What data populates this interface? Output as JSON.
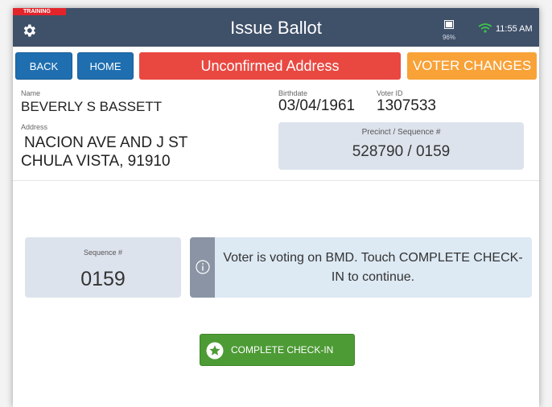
{
  "status_bar": {
    "training_label": "TRAINING",
    "settings_icon": "gear-icon",
    "title": "Issue Ballot",
    "battery_percent": "96%",
    "time": "11:55 AM"
  },
  "actions": {
    "back_label": "BACK",
    "home_label": "HOME",
    "address_status": "Unconfirmed Address",
    "voter_changes_label": "VOTER CHANGES"
  },
  "voter": {
    "name_label": "Name",
    "name": "BEVERLY S BASSETT",
    "birthdate_label": "Birthdate",
    "birthdate": "03/04/1961",
    "voter_id_label": "Voter ID",
    "voter_id": "1307533",
    "address_label": "Address",
    "address_line1": "NACION AVE AND J ST",
    "address_line2": "CHULA VISTA, 91910",
    "precinct_label": "Precinct / Sequence #",
    "precinct_value": "528790 / 0159"
  },
  "sequence": {
    "label": "Sequence #",
    "value": "0159"
  },
  "info": {
    "icon": "info-icon",
    "message": "Voter is voting on BMD. Touch COMPLETE CHECK-IN to continue."
  },
  "complete": {
    "icon": "star-icon",
    "label": "COMPLETE CHECK-IN"
  },
  "colors": {
    "header": "#3f5069",
    "training": "#e3242b",
    "primary_button": "#1f6fb0",
    "unconfirmed": "#e94841",
    "voter_changes": "#f8a238",
    "complete": "#4d9b35",
    "card": "#dde3ec",
    "info_bg": "#dde9f3"
  }
}
